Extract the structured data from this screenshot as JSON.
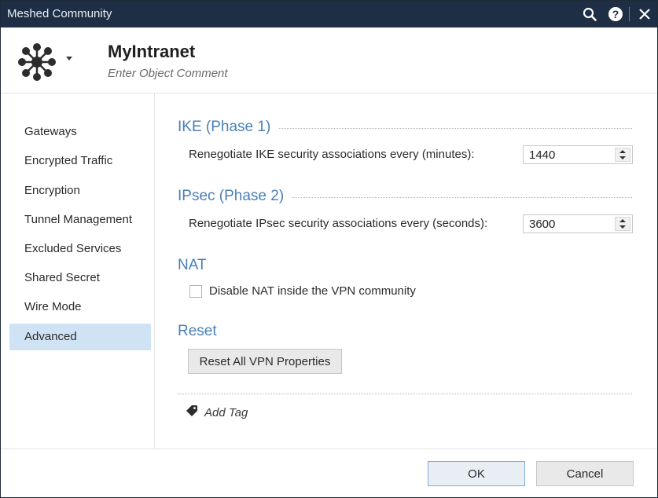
{
  "window": {
    "title": "Meshed Community"
  },
  "titlebar_icons": {
    "search": "search-icon",
    "help": "help-icon",
    "close": "close-icon"
  },
  "header": {
    "object_name": "MyIntranet",
    "comment_placeholder": "Enter Object Comment"
  },
  "sidebar": {
    "items": [
      {
        "label": "Gateways"
      },
      {
        "label": "Encrypted Traffic"
      },
      {
        "label": "Encryption"
      },
      {
        "label": "Tunnel Management"
      },
      {
        "label": "Excluded Services"
      },
      {
        "label": "Shared Secret"
      },
      {
        "label": "Wire Mode"
      },
      {
        "label": "Advanced",
        "active": true
      }
    ]
  },
  "main": {
    "ike": {
      "title": "IKE (Phase 1)",
      "label": "Renegotiate IKE security associations every (minutes):",
      "value": "1440"
    },
    "ipsec": {
      "title": "IPsec (Phase 2)",
      "label": "Renegotiate IPsec security associations every (seconds):",
      "value": "3600"
    },
    "nat": {
      "title": "NAT",
      "checkbox_label": "Disable NAT inside the VPN community",
      "checked": false
    },
    "reset": {
      "title": "Reset",
      "button_label": "Reset All VPN Properties"
    },
    "add_tag_label": "Add Tag"
  },
  "footer": {
    "ok_label": "OK",
    "cancel_label": "Cancel"
  },
  "colors": {
    "titlebar": "#1e2e44",
    "section_title": "#4a7fb6",
    "active_nav": "#cfe3f5"
  }
}
